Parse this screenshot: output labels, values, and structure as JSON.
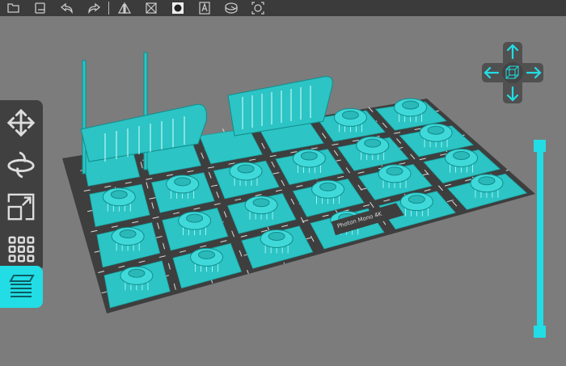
{
  "toolbar": {
    "buttons": [
      {
        "name": "open-file-icon"
      },
      {
        "name": "save-icon"
      },
      {
        "name": "undo-icon"
      },
      {
        "name": "redo-icon"
      },
      {
        "name": "mirror-icon"
      },
      {
        "name": "hollow-icon"
      },
      {
        "name": "fill-hole-icon"
      },
      {
        "name": "text-icon"
      },
      {
        "name": "layout-icon"
      },
      {
        "name": "inspect-icon"
      }
    ]
  },
  "sidebar": {
    "items": [
      {
        "name": "move-tool",
        "icon": "move-icon"
      },
      {
        "name": "rotate-tool",
        "icon": "rotate-icon"
      },
      {
        "name": "scale-tool",
        "icon": "scale-icon"
      },
      {
        "name": "arrange-tool",
        "icon": "grid-icon"
      }
    ],
    "slice_button": {
      "icon": "layers-icon"
    }
  },
  "scene": {
    "printer_label": "Photon Mono 4K"
  },
  "colors": {
    "accent": "#22dde5",
    "model": "#2cc4c4",
    "plate": "#3e3e3e",
    "background": "#7c7c7c"
  },
  "layer_slider": {
    "min_fraction": 0,
    "max_fraction": 1
  }
}
